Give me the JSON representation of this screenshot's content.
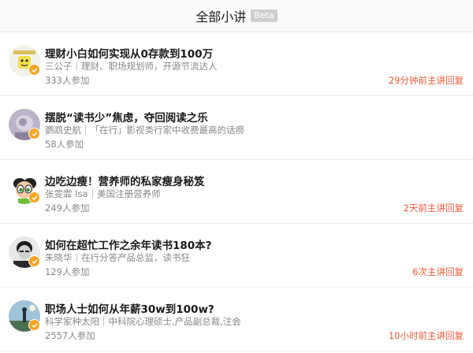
{
  "header": {
    "title": "全部小讲",
    "badge": "Beta"
  },
  "talks": [
    {
      "title": "理财小白如何实现从0存款到100万",
      "author": "三公子｜理财、职场规划师，开源节流达人",
      "count": "333人参加",
      "status": "29分钟前主讲回复"
    },
    {
      "title": "摆脱“读书少”焦虑，夺回阅读之乐",
      "author": "鹦鹉史航｜「在行」影视类行家中收费最高的话痨",
      "count": "58人参加",
      "status": ""
    },
    {
      "title": "边吃边瘦！营养师的私家瘦身秘笈",
      "author": "张雯霏 Isa｜美国注册营养师",
      "count": "249人参加",
      "status": "2天前主讲回复"
    },
    {
      "title": "如何在超忙工作之余年读书180本?",
      "author": "朱晓华｜在行分答产品总监，读书狂",
      "count": "129人参加",
      "status": "6次主讲回复"
    },
    {
      "title": "职场人士如何从年薪30w到100w?",
      "author": "科学家种太阳｜中科院心理硕士,产品副总裁,注会",
      "count": "2557人参加",
      "status": "10小时前主讲回复"
    }
  ],
  "colors": {
    "accent": "#f05a3a",
    "badge": "#f5a623"
  }
}
